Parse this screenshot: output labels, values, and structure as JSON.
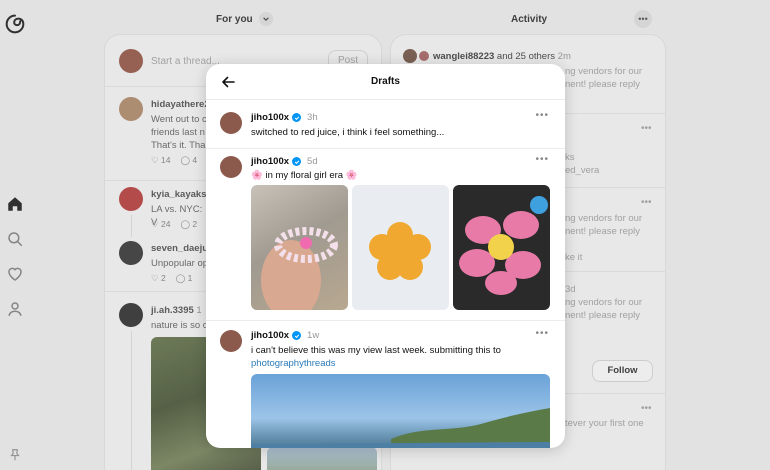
{
  "feed": {
    "header": "For you",
    "composer_placeholder": "Start a thread...",
    "post_label": "Post",
    "posts": [
      {
        "name": "hidayathere22",
        "lines": [
          "Went out to c",
          "friends last n",
          "That's it. Tha"
        ],
        "likes": "14",
        "replies": "4"
      },
      {
        "name": "kyia_kayaks",
        "lines": [
          "LA vs. NYC: V"
        ],
        "likes": "24",
        "replies": "2"
      },
      {
        "name": "seven_daejun",
        "lines": [
          "Unpopular op"
        ],
        "likes": "2",
        "replies": "1"
      },
      {
        "name": "ji.ah.3395",
        "time": "1",
        "lines": [
          "nature is so c"
        ]
      }
    ]
  },
  "activity": {
    "header": "Activity",
    "first_user": "wanglei88223",
    "first_rest": "and 25 others",
    "first_time": "2m",
    "snippets": [
      {
        "text": "ng vendors for our",
        "text2": "nent! please reply"
      },
      {
        "text": "ks",
        "text2": "ed_vera"
      },
      {
        "text": "ng vendors for our",
        "text2": "nent! please reply"
      },
      {
        "text": "ke it"
      },
      {
        "text": "3d"
      },
      {
        "text": "ng vendors for our",
        "text2": "nent! please reply"
      },
      {
        "text": "tever your first one"
      }
    ],
    "follow_label": "Follow"
  },
  "modal": {
    "title": "Drafts",
    "drafts": [
      {
        "user": "jiho100x",
        "time": "3h",
        "text": "switched to red juice, i think i feel something..."
      },
      {
        "user": "jiho100x",
        "time": "5d",
        "text": "🌸 in my floral girl era 🌸"
      },
      {
        "user": "jiho100x",
        "time": "1w",
        "text": "i can't believe this was my view last week. submitting this to",
        "link": "photographythreads"
      }
    ]
  },
  "colors": {
    "verified": "#0095f6",
    "link": "#2a7bb8"
  }
}
